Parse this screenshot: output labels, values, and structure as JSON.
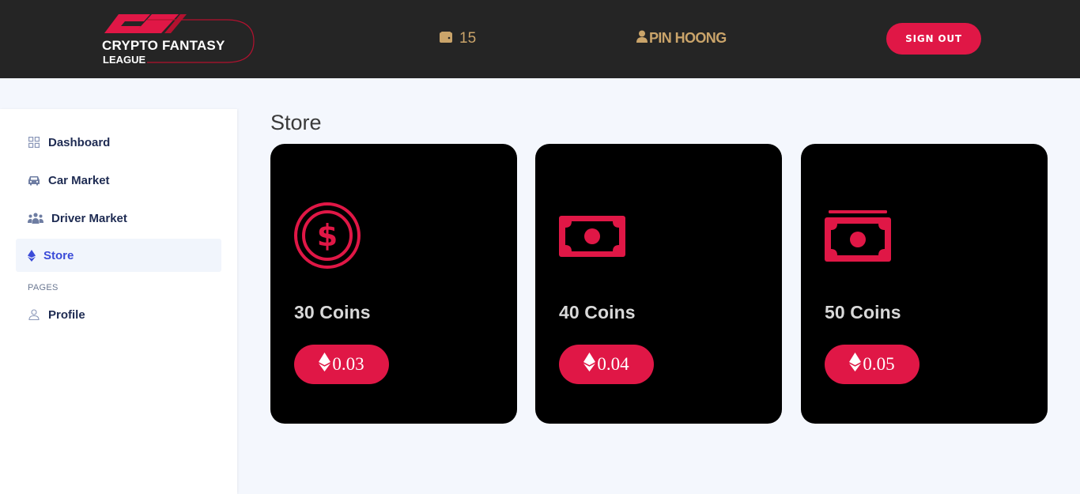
{
  "header": {
    "logo": {
      "line1": "CRYPTO FANTASY",
      "line2": "LEAGUE",
      "brand_color": "#e01746"
    },
    "wallet": {
      "icon": "wallet-icon",
      "value": "15"
    },
    "user": {
      "icon": "user-icon",
      "name": "PIN HOONG"
    },
    "sign_out_label": "SIGN OUT"
  },
  "sidebar": {
    "items": [
      {
        "label": "Dashboard",
        "icon": "grid-icon"
      },
      {
        "label": "Car Market",
        "icon": "car-icon"
      },
      {
        "label": "Driver Market",
        "icon": "users-icon"
      },
      {
        "label": "Store",
        "icon": "ethereum-icon",
        "active": true
      }
    ],
    "section_label": "PAGES",
    "pages": [
      {
        "label": "Profile",
        "icon": "user-outline-icon"
      }
    ]
  },
  "main": {
    "title": "Store",
    "cards": [
      {
        "label": "30 Coins",
        "price": "0.03",
        "icon": "dollar-circle-icon"
      },
      {
        "label": "40 Coins",
        "price": "0.04",
        "icon": "money-bill-icon"
      },
      {
        "label": "50 Coins",
        "price": "0.05",
        "icon": "money-bills-icon"
      }
    ]
  },
  "colors": {
    "accent": "#e01746",
    "header_bg": "#252525",
    "gold": "#caa46a",
    "active_nav": "#3b4bd8",
    "card_bg": "#000000"
  }
}
